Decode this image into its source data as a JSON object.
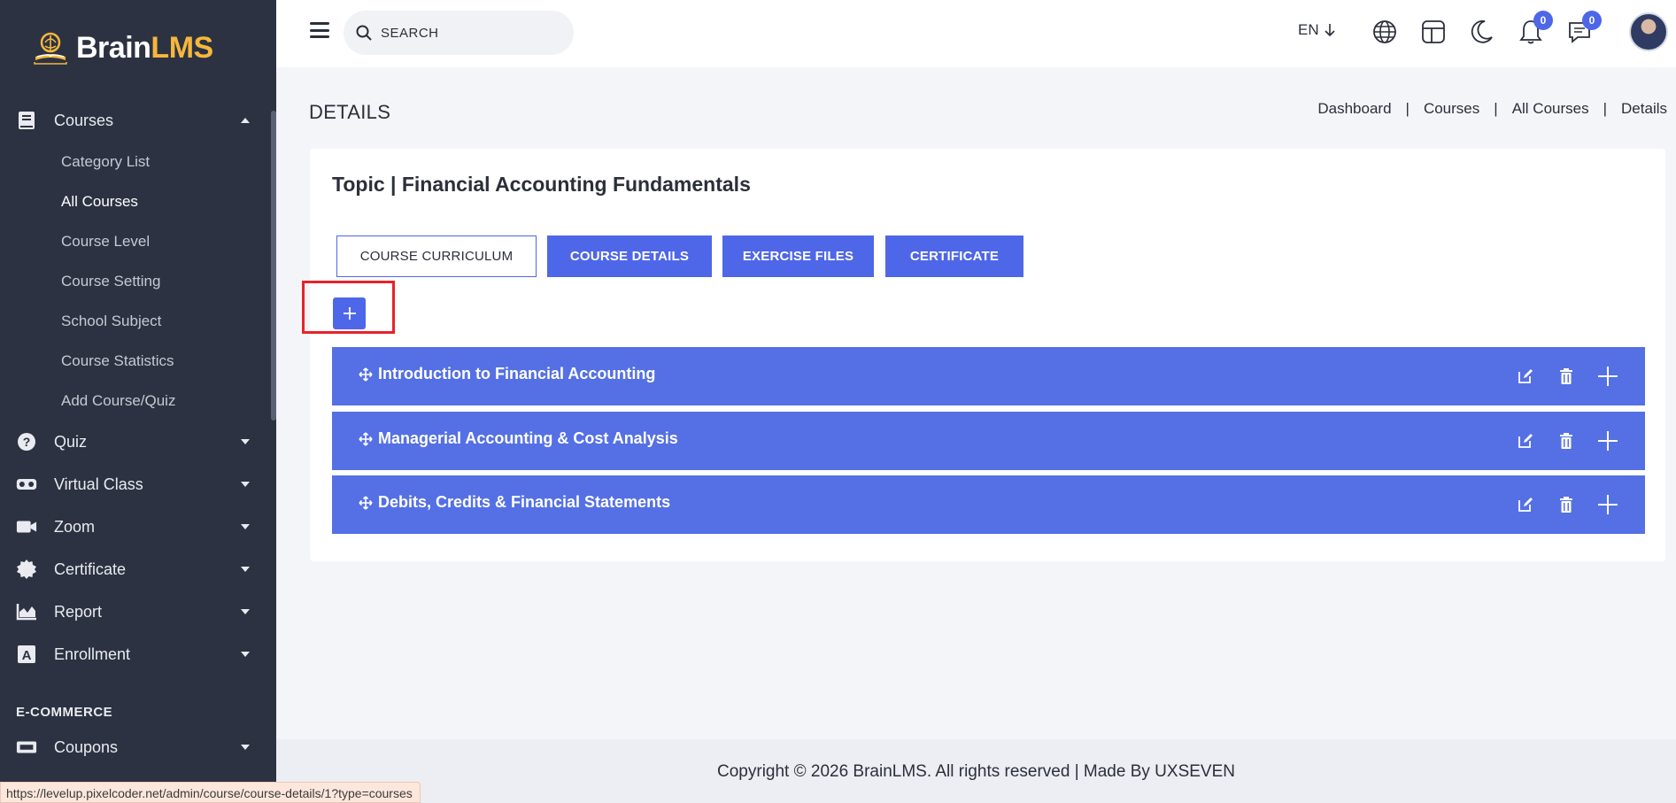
{
  "brand": {
    "name_part1": "Brain",
    "name_part2": "LMS"
  },
  "search": {
    "placeholder": "SEARCH"
  },
  "topbar": {
    "language": "EN",
    "notifications_count": "0",
    "messages_count": "0"
  },
  "sidebar": {
    "courses": {
      "label": "Courses",
      "icon": "book-icon"
    },
    "submenu": [
      "Category List",
      "All Courses",
      "Course Level",
      "Course Setting",
      "School Subject",
      "Course Statistics",
      "Add Course/Quiz"
    ],
    "active_submenu": "All Courses",
    "items": [
      {
        "label": "Quiz",
        "icon": "question-circle-icon"
      },
      {
        "label": "Virtual Class",
        "icon": "vr-headset-icon"
      },
      {
        "label": "Zoom",
        "icon": "video-camera-icon"
      },
      {
        "label": "Certificate",
        "icon": "certificate-icon"
      },
      {
        "label": "Report",
        "icon": "chart-area-icon"
      },
      {
        "label": "Enrollment",
        "icon": "enrollment-icon"
      }
    ],
    "section_title": "E-COMMERCE",
    "ecommerce_items": [
      {
        "label": "Coupons",
        "icon": "ticket-icon"
      }
    ]
  },
  "page": {
    "title": "DETAILS",
    "breadcrumb": [
      "Dashboard",
      "Courses",
      "All Courses",
      "Details"
    ],
    "topic": "Topic | Financial Accounting Fundamentals"
  },
  "tabs": [
    {
      "label": "COURSE CURRICULUM",
      "active": true
    },
    {
      "label": "COURSE DETAILS",
      "active": false
    },
    {
      "label": "EXERCISE FILES",
      "active": false
    },
    {
      "label": "CERTIFICATE",
      "active": false
    }
  ],
  "add_button": {
    "label": "+"
  },
  "sections": [
    {
      "title": "Introduction to Financial Accounting"
    },
    {
      "title": "Managerial Accounting & Cost Analysis"
    },
    {
      "title": "Debits, Credits & Financial Statements"
    }
  ],
  "colors": {
    "primary": "#4e67e8",
    "sidebar_bg": "#2c3242",
    "highlight": "#e8222a",
    "brand_accent": "#f6b73c"
  },
  "footer": {
    "copyright": "Copyright © 2026 BrainLMS. All rights reserved | Made By UXSEVEN"
  },
  "status_url": "https://levelup.pixelcoder.net/admin/course/course-details/1?type=courses"
}
